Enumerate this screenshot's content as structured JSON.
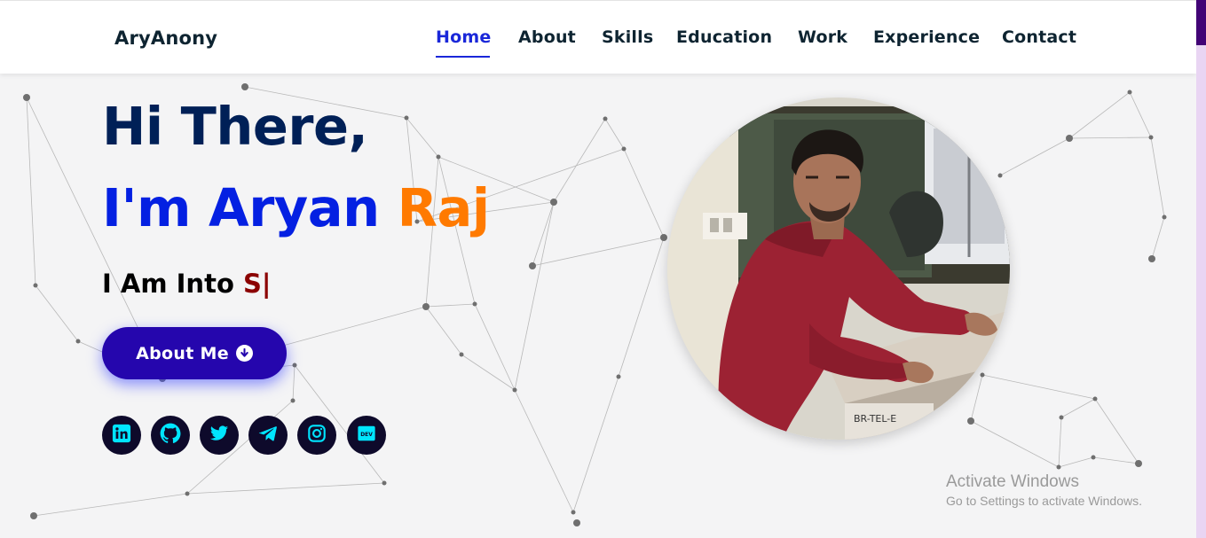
{
  "nav": {
    "brand": "AryAnony",
    "links": [
      "Home",
      "About",
      "Skills",
      "Education",
      "Work",
      "Experience",
      "Contact"
    ],
    "active": "Home"
  },
  "hero": {
    "greeting": "Hi There,",
    "name_prefix": "I'm Aryan",
    "name_last": "Raj",
    "typed_prefix": "I Am Into",
    "typed_text": "S|",
    "button_label": "About Me",
    "button_icon": "arrow-circle-down-icon"
  },
  "socials": [
    {
      "name": "linkedin",
      "icon": "linkedin-icon"
    },
    {
      "name": "github",
      "icon": "github-icon"
    },
    {
      "name": "twitter",
      "icon": "twitter-icon"
    },
    {
      "name": "telegram",
      "icon": "telegram-icon"
    },
    {
      "name": "instagram",
      "icon": "instagram-icon"
    },
    {
      "name": "dev",
      "icon": "dev-icon",
      "label": "DEV"
    }
  ],
  "profile": {
    "subject": "profile photo",
    "label_text": "BR-TEL-E"
  },
  "watermark": {
    "title": "Activate Windows",
    "subtitle": "Go to Settings to activate Windows."
  },
  "colors": {
    "accent_blue": "#0420e2",
    "accent_orange": "#ff7a00",
    "button_bg": "#2506ad",
    "typed_text": "#8b0000",
    "heading_dark": "#002057",
    "social_bg": "#0e0a2b",
    "social_icon": "#00e5ff"
  }
}
